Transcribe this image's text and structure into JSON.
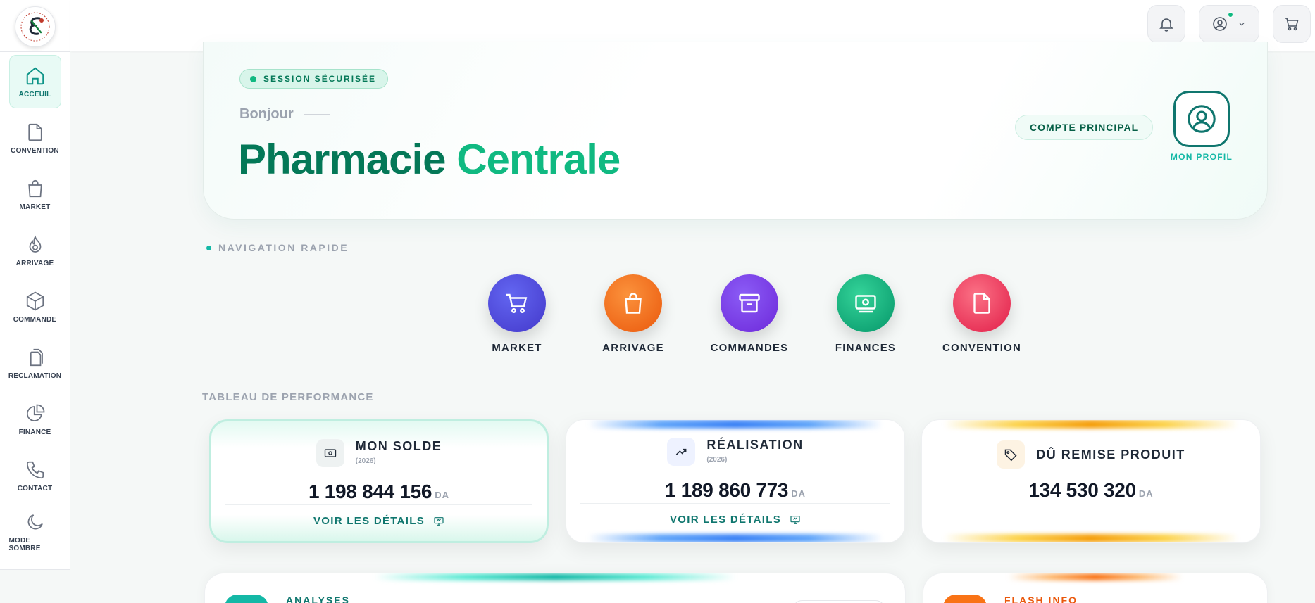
{
  "sidebar": {
    "logo_alt": "Logo",
    "items": [
      {
        "label": "ACCEUIL",
        "icon": "home-icon",
        "active": true
      },
      {
        "label": "CONVENTION",
        "icon": "file-icon"
      },
      {
        "label": "MARKET",
        "icon": "shopping-bag-icon"
      },
      {
        "label": "ARRIVAGE",
        "icon": "flame-icon"
      },
      {
        "label": "COMMANDE",
        "icon": "box-icon"
      },
      {
        "label": "RECLAMATION",
        "icon": "files-icon"
      },
      {
        "label": "FINANCE",
        "icon": "pie-chart-icon"
      },
      {
        "label": "CONTACT",
        "icon": "phone-icon"
      },
      {
        "label": "MODE SOMBRE",
        "icon": "moon-icon"
      }
    ]
  },
  "topbar": {
    "notify_icon": "bell-icon",
    "profile_icon": "user-circle-icon",
    "cart_icon": "cart-icon"
  },
  "hero": {
    "session_label": "SESSION SÉCURISÉE",
    "greeting": "Bonjour",
    "title_part1": "Pharmacie",
    "title_part2": "Centrale",
    "account_label": "COMPTE PRINCIPAL",
    "profile_label": "MON PROFIL"
  },
  "quick_nav": {
    "heading": "NAVIGATION RAPIDE",
    "items": [
      {
        "label": "MARKET",
        "color": "#4f46e5",
        "icon": "cart-icon"
      },
      {
        "label": "ARRIVAGE",
        "color": "#f97316",
        "icon": "shopping-bag-icon"
      },
      {
        "label": "COMMANDES",
        "color": "#7c3aed",
        "icon": "archive-icon"
      },
      {
        "label": "FINANCES",
        "color": "#10b981",
        "icon": "banknote-icon"
      },
      {
        "label": "CONVENTION",
        "color": "#f43f5e",
        "icon": "file-icon"
      }
    ]
  },
  "performance": {
    "heading": "TABLEAU DE PERFORMANCE",
    "cards": [
      {
        "title": "MON SOLDE",
        "sub": "(2026)",
        "value": "1 198 844 156",
        "unit": "DA",
        "link": "VOIR LES DÉTAILS"
      },
      {
        "title": "RÉALISATION",
        "sub": "(2026)",
        "value": "1 189 860 773",
        "unit": "DA",
        "link": "VOIR LES DÉTAILS"
      },
      {
        "title": "DÛ REMISE PRODUIT",
        "value": "134 530 320",
        "unit": "DA"
      }
    ]
  },
  "bottom": {
    "analyses_title": "ANALYSES",
    "flash_title": "FLASH INFO"
  },
  "colors": {
    "brand_dark": "#047857",
    "brand_light": "#10b981",
    "accent": "#0f766e"
  }
}
